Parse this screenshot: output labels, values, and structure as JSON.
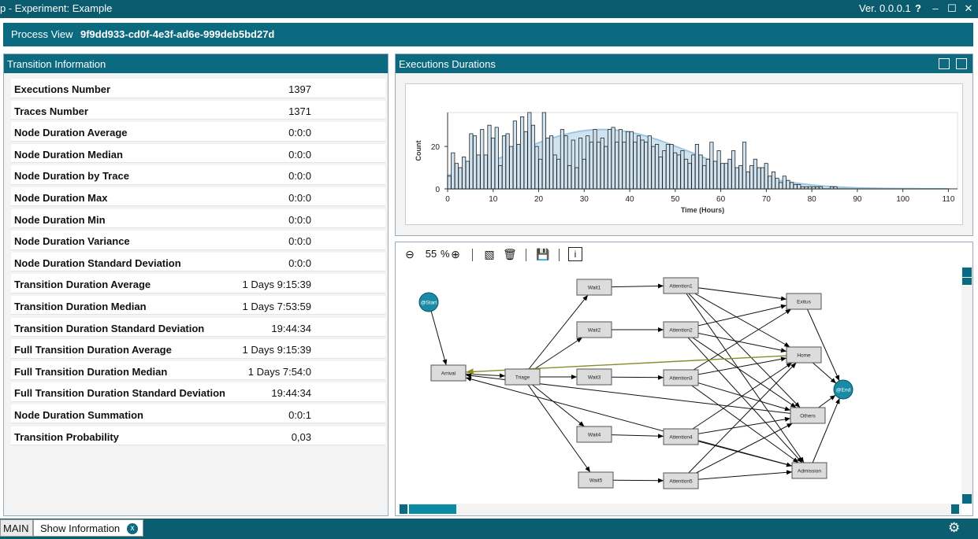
{
  "window": {
    "title": "p  -  Experiment: Example",
    "version": "Ver. 0.0.0.1",
    "help_icon": "?",
    "minimize_icon": "–",
    "maximize_icon": "☐",
    "close_icon": "✕"
  },
  "process": {
    "label": "Process View",
    "id": "9f9dd933-cd0f-4e3f-ad6e-999deb5bd27d"
  },
  "transition_info": {
    "title": "Transition Information",
    "rows": [
      {
        "label": "Executions Number",
        "value": "1397"
      },
      {
        "label": "Traces Number",
        "value": "1371"
      },
      {
        "label": "Node Duration Average",
        "value": "0:0:0"
      },
      {
        "label": "Node Duration Median",
        "value": "0:0:0"
      },
      {
        "label": "Node Duration by Trace",
        "value": "0:0:0"
      },
      {
        "label": "Node Duration Max",
        "value": "0:0:0"
      },
      {
        "label": "Node Duration Min",
        "value": "0:0:0"
      },
      {
        "label": "Node Duration Variance",
        "value": "0:0:0"
      },
      {
        "label": "Node Duration Standard Deviation",
        "value": "0:0:0"
      },
      {
        "label": "Transition Duration Average",
        "value": "1 Days 9:15:39"
      },
      {
        "label": "Transition Duration Median",
        "value": "1 Days 7:53:59"
      },
      {
        "label": "Transition Duration Standard Deviation",
        "value": "19:44:34"
      },
      {
        "label": "Full Transition Duration Average",
        "value": "1 Days 9:15:39"
      },
      {
        "label": "Full Transition Duration Median",
        "value": "1 Days 7:54:0"
      },
      {
        "label": "Full Transition Duration Standard Deviation",
        "value": "19:44:34"
      },
      {
        "label": "Node Duration Summation",
        "value": "0:0:1"
      },
      {
        "label": "Transition Probability",
        "value": "0,03"
      }
    ]
  },
  "executions": {
    "title": "Executions Durations",
    "copy_icon": "copy-icon",
    "chart_icon": "chart-icon"
  },
  "chart_data": {
    "type": "bar",
    "xlabel": "Time (Hours)",
    "ylabel": "Count",
    "xlim": [
      0,
      112
    ],
    "ylim": [
      0,
      36
    ],
    "xticks": [
      "0",
      "10",
      "20",
      "30",
      "40",
      "50",
      "60",
      "70",
      "80",
      "90",
      "100",
      "110"
    ],
    "yticks": [
      "0",
      "20"
    ],
    "bin_width": 0.8,
    "x": [
      0,
      0.8,
      1.6,
      2.4,
      3.2,
      4,
      4.8,
      5.6,
      6.4,
      7.2,
      8,
      8.8,
      9.6,
      10.4,
      11.2,
      12,
      12.8,
      13.6,
      14.4,
      15.2,
      16,
      16.8,
      17.6,
      18.4,
      19.2,
      20,
      20.8,
      21.6,
      22.4,
      23.2,
      24,
      24.8,
      25.6,
      26.4,
      27.2,
      28,
      28.8,
      29.6,
      30.4,
      31.2,
      32,
      32.8,
      33.6,
      34.4,
      35.2,
      36,
      36.8,
      37.6,
      38.4,
      39.2,
      40,
      40.8,
      41.6,
      42.4,
      43.2,
      44,
      44.8,
      45.6,
      46.4,
      47.2,
      48,
      48.8,
      49.6,
      50.4,
      51.2,
      52,
      52.8,
      53.6,
      54.4,
      55.2,
      56,
      56.8,
      57.6,
      58.4,
      59.2,
      60,
      60.8,
      61.6,
      62.4,
      63.2,
      64,
      64.8,
      65.6,
      66.4,
      67.2,
      68,
      68.8,
      69.6,
      70.4,
      71.2,
      72,
      72.8,
      73.6,
      74.4,
      75.2,
      76,
      76.8,
      77.6,
      78.4,
      79.2,
      80,
      80.8,
      81.6,
      82.4,
      83.2,
      84,
      84.8,
      85.6,
      86.4,
      87.2,
      88,
      88.8,
      89.6,
      90.4,
      91.2,
      92,
      92.8,
      93.6,
      94.4,
      95.2,
      96,
      96.8,
      97.6,
      98.4,
      99.2,
      100,
      100.8,
      101.6,
      102.4,
      103.2,
      104,
      104.8,
      105.6,
      106.4,
      107.2,
      108,
      108.8,
      109.6,
      110.4,
      111.2
    ],
    "values": [
      6,
      17,
      12,
      10,
      15,
      13,
      26,
      25,
      16,
      28,
      16,
      30,
      24,
      29,
      11,
      25,
      26,
      20,
      32,
      21,
      34,
      27,
      36,
      30,
      20,
      14,
      36,
      24,
      25,
      16,
      14,
      28,
      25,
      11,
      23,
      10,
      24,
      14,
      25,
      22,
      28,
      22,
      24,
      20,
      28,
      29,
      22,
      28,
      22,
      27,
      27,
      22,
      25,
      23,
      22,
      25,
      20,
      21,
      15,
      18,
      21,
      21,
      17,
      16,
      18,
      14,
      12,
      16,
      21,
      16,
      11,
      14,
      22,
      13,
      18,
      12,
      12,
      14,
      18,
      10,
      11,
      22,
      8,
      11,
      14,
      10,
      10,
      12,
      6,
      8,
      5,
      3,
      6,
      4,
      3,
      2,
      2,
      1,
      1,
      1,
      1,
      1,
      1,
      0,
      0,
      1,
      1,
      0,
      0,
      0,
      0,
      0,
      0,
      0,
      0,
      0,
      0,
      0,
      0,
      0,
      0,
      0,
      0,
      0,
      0,
      0,
      0,
      0,
      0,
      0,
      0,
      0,
      0,
      0,
      0,
      0,
      0,
      0,
      0,
      0
    ],
    "fit_curve": {
      "mean": 34,
      "sd": 19.7,
      "peak": 28
    }
  },
  "graph": {
    "zoom_out_icon": "zoom-out-icon",
    "zoom_value": "55",
    "zoom_unit": "%",
    "zoom_in_icon": "zoom-in-icon",
    "image_icon": "image-icon",
    "delete_icon": "trash-icon",
    "save_icon": "save-icon",
    "info_icon": "info-icon",
    "nodes": [
      {
        "id": "start",
        "label": "@Start"
      },
      {
        "id": "arrival",
        "label": "Arrival"
      },
      {
        "id": "triage",
        "label": "Triage"
      },
      {
        "id": "wait1",
        "label": "Wait1"
      },
      {
        "id": "wait2",
        "label": "Wait2"
      },
      {
        "id": "wait3",
        "label": "Wait3"
      },
      {
        "id": "wait4",
        "label": "Wait4"
      },
      {
        "id": "wait5",
        "label": "Wait5"
      },
      {
        "id": "att1",
        "label": "Attention1"
      },
      {
        "id": "att2",
        "label": "Attention2"
      },
      {
        "id": "att3",
        "label": "Attention3"
      },
      {
        "id": "att4",
        "label": "Attention4"
      },
      {
        "id": "att5",
        "label": "Attention5"
      },
      {
        "id": "exitus",
        "label": "Exitus"
      },
      {
        "id": "home",
        "label": "Home"
      },
      {
        "id": "others",
        "label": "Others"
      },
      {
        "id": "admission",
        "label": "Admission"
      },
      {
        "id": "end",
        "label": "@End"
      }
    ],
    "edges": [
      [
        "start",
        "arrival"
      ],
      [
        "arrival",
        "triage"
      ],
      [
        "triage",
        "wait1"
      ],
      [
        "triage",
        "wait2"
      ],
      [
        "triage",
        "wait3"
      ],
      [
        "triage",
        "wait4"
      ],
      [
        "triage",
        "wait5"
      ],
      [
        "wait1",
        "att1"
      ],
      [
        "wait2",
        "att2"
      ],
      [
        "wait3",
        "att3"
      ],
      [
        "wait4",
        "att4"
      ],
      [
        "wait5",
        "att5"
      ],
      [
        "att1",
        "exitus"
      ],
      [
        "att1",
        "home"
      ],
      [
        "att1",
        "others"
      ],
      [
        "att1",
        "admission"
      ],
      [
        "att2",
        "exitus"
      ],
      [
        "att2",
        "home"
      ],
      [
        "att2",
        "others"
      ],
      [
        "att2",
        "admission"
      ],
      [
        "att3",
        "exitus"
      ],
      [
        "att3",
        "home"
      ],
      [
        "att3",
        "others"
      ],
      [
        "att3",
        "admission"
      ],
      [
        "att4",
        "home"
      ],
      [
        "att4",
        "others"
      ],
      [
        "att4",
        "admission"
      ],
      [
        "att5",
        "home"
      ],
      [
        "att5",
        "others"
      ],
      [
        "att5",
        "admission"
      ],
      [
        "exitus",
        "end"
      ],
      [
        "home",
        "end"
      ],
      [
        "others",
        "end"
      ],
      [
        "admission",
        "end"
      ],
      [
        "home",
        "arrival"
      ],
      [
        "others",
        "arrival"
      ],
      [
        "admission",
        "arrival"
      ]
    ],
    "highlighted_edge": [
      "home",
      "arrival"
    ],
    "node_color": "#dcdcdc",
    "terminal_color": "#1a8ba6",
    "highlight_color": "#8a8a2a"
  },
  "footer": {
    "main_tab": "MAIN",
    "show_tab": "Show Information",
    "close_icon": "x",
    "settings_icon": "gears-icon"
  }
}
